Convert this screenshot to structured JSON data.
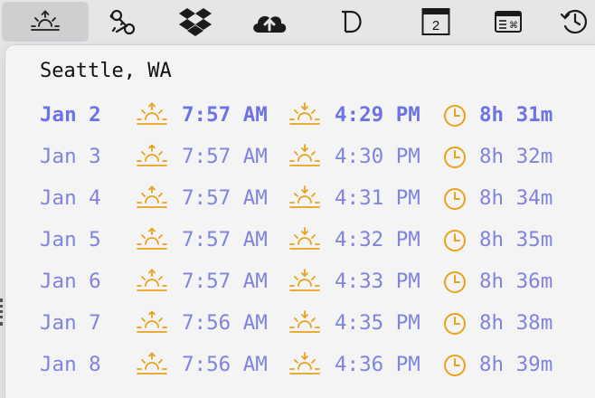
{
  "menubar": {
    "items": [
      {
        "icon": "sunrise-sunset-icon",
        "active": true
      },
      {
        "icon": "keys-icon",
        "active": false
      },
      {
        "icon": "dropbox-icon",
        "active": false
      },
      {
        "icon": "cloud-upload-icon",
        "active": false
      },
      {
        "icon": "d-app-icon",
        "active": false
      },
      {
        "icon": "calendar-icon",
        "badge": "2",
        "active": false
      },
      {
        "icon": "keyboard-shortcut-icon",
        "active": false
      },
      {
        "icon": "time-machine-icon",
        "active": false
      }
    ]
  },
  "panel": {
    "location": "Seattle, WA",
    "rows": [
      {
        "date": "Jan 2",
        "sunrise": "7:57 AM",
        "sunset": "4:29 PM",
        "length": "8h 31m",
        "today": true
      },
      {
        "date": "Jan 3",
        "sunrise": "7:57 AM",
        "sunset": "4:30 PM",
        "length": "8h 32m"
      },
      {
        "date": "Jan 4",
        "sunrise": "7:57 AM",
        "sunset": "4:31 PM",
        "length": "8h 34m"
      },
      {
        "date": "Jan 5",
        "sunrise": "7:57 AM",
        "sunset": "4:32 PM",
        "length": "8h 35m"
      },
      {
        "date": "Jan 6",
        "sunrise": "7:57 AM",
        "sunset": "4:33 PM",
        "length": "8h 36m"
      },
      {
        "date": "Jan 7",
        "sunrise": "7:56 AM",
        "sunset": "4:35 PM",
        "length": "8h 38m"
      },
      {
        "date": "Jan 8",
        "sunrise": "7:56 AM",
        "sunset": "4:36 PM",
        "length": "8h 39m"
      }
    ]
  },
  "colors": {
    "row_text": "#7f84dc",
    "today_text": "#6d72e6",
    "icon_orange": "#e9a21b",
    "location_text": "#111111"
  }
}
